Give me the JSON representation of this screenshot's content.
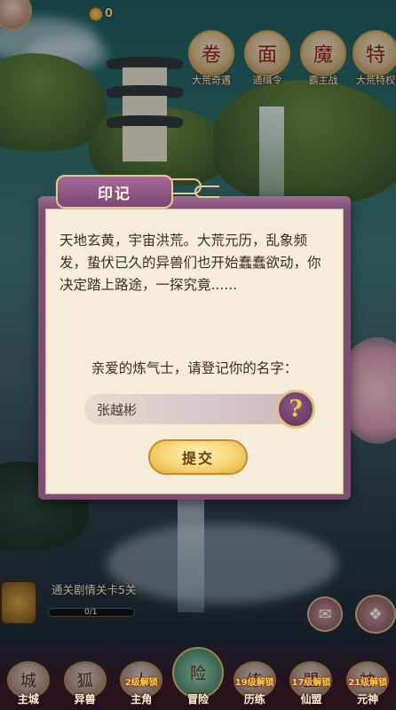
{
  "hud": {
    "currency_value": "0"
  },
  "top_menu": [
    {
      "label": "大荒奇遇",
      "icon": "scroll-icon"
    },
    {
      "label": "通缉令",
      "icon": "mask-icon"
    },
    {
      "label": "霸主战",
      "icon": "demon-mask-icon"
    },
    {
      "label": "大荒特权",
      "icon": "privilege-icon"
    }
  ],
  "dialog": {
    "title": "印记",
    "story": "天地玄黄，宇宙洪荒。大荒元历，乱象频发，蛰伏已久的异兽们也开始蠢蠢欲动，你决定踏上路途，一探究竟......",
    "prompt": "亲爱的炼气士，请登记你的名字：",
    "name_value": "张越彬",
    "help_symbol": "?",
    "submit_label": "提交"
  },
  "quest": {
    "text": "通关剧情关卡5关",
    "progress": "0/1"
  },
  "bottom_nav": [
    {
      "label": "主城",
      "icon": "city-icon",
      "lock": ""
    },
    {
      "label": "异兽",
      "icon": "fox-icon",
      "lock": ""
    },
    {
      "label": "主角",
      "icon": "hero-icon",
      "lock": "2级解锁"
    },
    {
      "label": "冒险",
      "icon": "adventure-icon",
      "lock": ""
    },
    {
      "label": "历练",
      "icon": "training-icon",
      "lock": "19级解锁"
    },
    {
      "label": "仙盟",
      "icon": "alliance-icon",
      "lock": "17级解锁"
    },
    {
      "label": "元神",
      "icon": "spirit-icon",
      "lock": "21级解锁"
    }
  ]
}
